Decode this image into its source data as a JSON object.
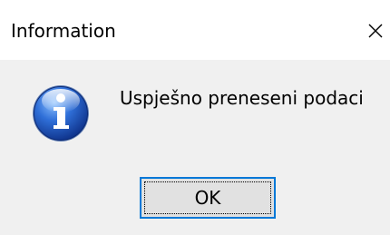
{
  "window": {
    "title": "Information",
    "close_icon": "close-x-icon"
  },
  "content": {
    "icon": "information-icon",
    "message": "Uspješno preneseni podaci"
  },
  "buttons": {
    "ok_label": "OK"
  },
  "colors": {
    "titlebar_bg": "#ffffff",
    "dialog_bg": "#f0f0f0",
    "button_bg": "#e1e1e1",
    "button_focus_border": "#0078d7",
    "icon_blue": "#1a5fb4"
  }
}
